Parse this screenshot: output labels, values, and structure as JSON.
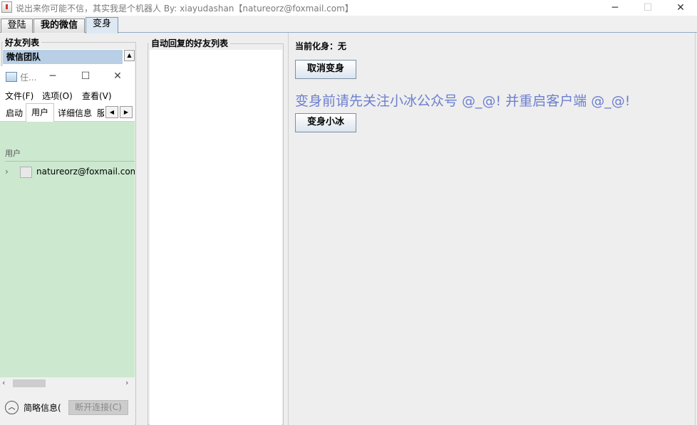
{
  "window": {
    "title": "说出来你可能不信，其实我是个机器人 By: xiayudashan【natureorz@foxmail.com】",
    "minimize": "─",
    "maximize": "☐",
    "close": "✕"
  },
  "tabs": [
    {
      "label": "登陆"
    },
    {
      "label": "我的微信"
    },
    {
      "label": "变身"
    }
  ],
  "friend_list": {
    "title": "好友列表",
    "selected_item": "微信团队"
  },
  "auto_reply": {
    "title": "自动回复的好友列表"
  },
  "transform": {
    "current_label": "当前化身：无",
    "cancel_button": "取消变身",
    "hint": "变身前请先关注小冰公众号 @_@! 并重启客户端 @_@!",
    "xiaobing_button": "变身小冰"
  },
  "task_manager": {
    "title": "任...",
    "minimize": "─",
    "maximize": "☐",
    "close": "✕",
    "menu": [
      "文件(F)",
      "选项(O)",
      "查看(V)"
    ],
    "tabs": [
      "启动",
      "用户",
      "详细信息",
      "服"
    ],
    "selected_tab": "用户",
    "column_header": "用户",
    "user": "natureorz@foxmail.com",
    "footer_label": "简略信息(",
    "disconnect_button": "断开连接(C)"
  }
}
